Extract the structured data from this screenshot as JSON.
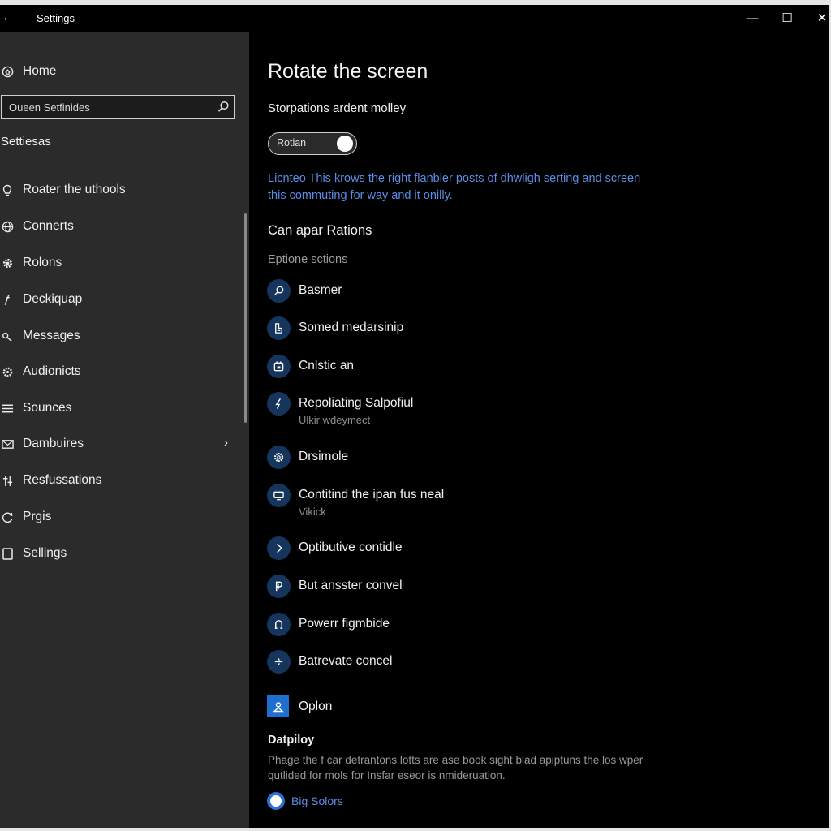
{
  "window": {
    "title": "Settings",
    "back_glyph": "←",
    "minimize_glyph": "—",
    "maximize_glyph": "☐",
    "close_glyph": "✕"
  },
  "sidebar": {
    "home_label": "Home",
    "search_placeholder": "Oueen Setfinides",
    "section_label": "Settiesas",
    "items": [
      {
        "label": "Roater the uthools",
        "icon": "lightbulb-icon"
      },
      {
        "label": "Connerts",
        "icon": "globe-icon"
      },
      {
        "label": "Rolons",
        "icon": "gear-icon"
      },
      {
        "label": "Deckiquap",
        "icon": "pen-icon"
      },
      {
        "label": "Messages",
        "icon": "key-icon"
      },
      {
        "label": "Audionicts",
        "icon": "audio-icon"
      },
      {
        "label": "Sounces",
        "icon": "list-icon"
      },
      {
        "label": "Dambuires",
        "icon": "mail-icon"
      },
      {
        "label": "Resfussations",
        "icon": "sliders-icon"
      },
      {
        "label": "Prgis",
        "icon": "refresh-icon"
      },
      {
        "label": "Sellings",
        "icon": "square-icon"
      }
    ]
  },
  "main": {
    "title": "Rotate the screen",
    "subheading": "Storpations ardent molley",
    "toggle_label": "Rotian",
    "toggle_on": true,
    "description": "Licnteo This krows the right flanbler posts of dhwligh serting and screen this commuting for way and it onilly.",
    "heading2": "Can apar Rations",
    "grey_label": "Eptione sctions",
    "options": [
      {
        "label": "Basmer",
        "sub": "",
        "icon": "search-icon"
      },
      {
        "label": "Somed medarsinip",
        "sub": "",
        "icon": "document-icon"
      },
      {
        "label": "Cnlstic an",
        "sub": "",
        "icon": "calendar-icon"
      },
      {
        "label": "Repoliating Salpofiul",
        "sub": "Ulkir wdeymect",
        "icon": "lightning-icon"
      },
      {
        "label": "Drsimole",
        "sub": "",
        "icon": "settings-icon"
      },
      {
        "label": "Contitind the ipan fus neal",
        "sub": "Vikick",
        "icon": "monitor-icon"
      },
      {
        "label": "Optibutive contidle",
        "sub": "",
        "icon": "play-icon"
      },
      {
        "label": "But ansster convel",
        "sub": "",
        "icon": "parking-icon"
      },
      {
        "label": "Powerr figmbide",
        "sub": "",
        "icon": "headphones-icon"
      },
      {
        "label": "Batrevate concel",
        "sub": "",
        "icon": "share-icon"
      }
    ],
    "square_option": "Oplon",
    "display_title": "Datpiloy",
    "display_desc": "Phage the f car detrantons lotts are ase book sight blad apiptuns the los wper qutlided for mols for Insfar eseor is nmideruation.",
    "radio_label": "Big Solors"
  },
  "colors": {
    "sidebar_bg": "#2b2b2b",
    "main_bg": "#000000",
    "accent_blue": "#5b8ce6",
    "icon_circle": "#16355c"
  }
}
